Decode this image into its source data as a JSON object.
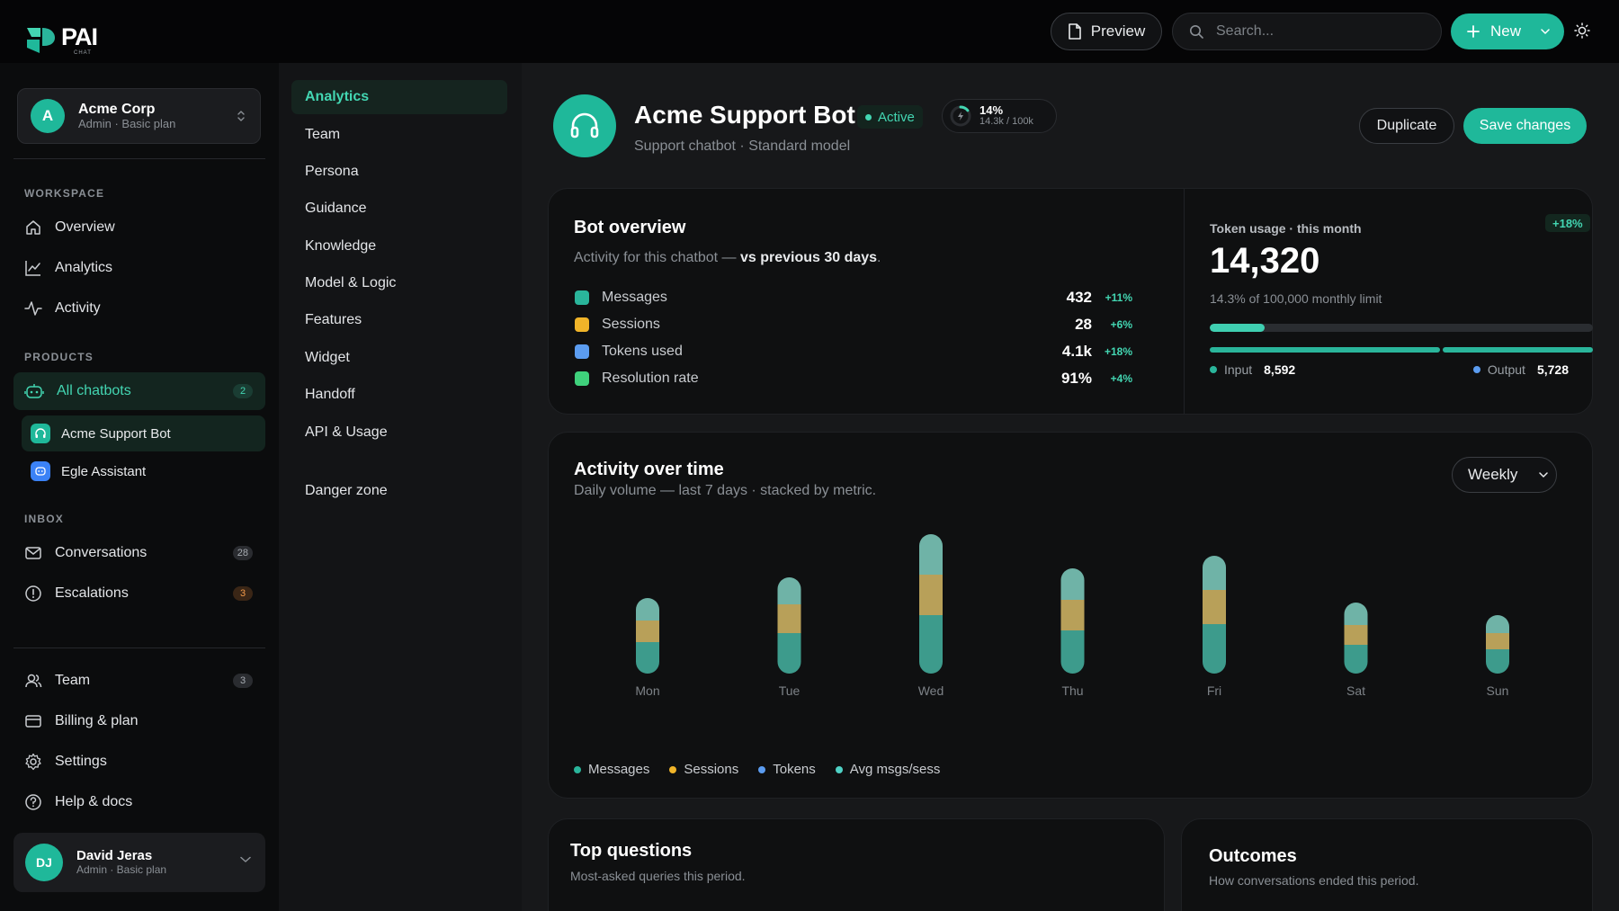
{
  "app": {
    "logo_text": "PAI",
    "logo_sub": "CHAT"
  },
  "topbar": {
    "preview_label": "Preview",
    "search_placeholder": "Search...",
    "new_label": "New"
  },
  "org": {
    "initial": "A",
    "name": "Acme Corp",
    "sub": "Admin · Basic plan"
  },
  "sidebar": {
    "workspace_label": "WORKSPACE",
    "workspace_items": [
      {
        "label": "Overview",
        "icon": "home-icon"
      },
      {
        "label": "Analytics",
        "icon": "line-chart-icon"
      },
      {
        "label": "Activity",
        "icon": "pulse-icon"
      }
    ],
    "products_label": "PRODUCTS",
    "all_chatbots": {
      "label": "All chatbots",
      "badge": "2"
    },
    "bots": [
      {
        "label": "Acme Support Bot",
        "color": "#1fb89a"
      },
      {
        "label": "Egle Assistant",
        "color": "#3b82f6"
      }
    ],
    "inbox_label": "INBOX",
    "inbox_items": [
      {
        "label": "Conversations",
        "badge": "28"
      },
      {
        "label": "Escalations",
        "badge": "3"
      }
    ],
    "bottom_items": [
      {
        "label": "Team",
        "badge": "3"
      },
      {
        "label": "Billing & plan"
      },
      {
        "label": "Settings"
      },
      {
        "label": "Help & docs"
      }
    ]
  },
  "user": {
    "initials": "DJ",
    "name": "David Jeras",
    "sub": "Admin · Basic plan"
  },
  "subnav": {
    "items": [
      "Analytics",
      "Team",
      "Persona",
      "Guidance",
      "Knowledge",
      "Model & Logic",
      "Features",
      "Widget",
      "Handoff",
      "API & Usage"
    ],
    "danger": "Danger zone"
  },
  "bot": {
    "name": "Acme Support Bot",
    "status": "Active",
    "usage_pct": "14%",
    "usage_sub": "14.3k / 100k",
    "usage_fraction": 0.143,
    "subtitle": "Support chatbot · Standard model",
    "duplicate_label": "Duplicate",
    "save_label": "Save changes"
  },
  "overview": {
    "title": "Bot overview",
    "subtitle_prefix": "Activity for this chatbot — ",
    "subtitle_bold": "vs previous 30 days",
    "subtitle_suffix": ".",
    "metrics": [
      {
        "label": "Messages",
        "value": "432",
        "delta": "+11%",
        "color": "#2ab59b"
      },
      {
        "label": "Sessions",
        "value": "28",
        "delta": "+6%",
        "color": "#f0b429"
      },
      {
        "label": "Tokens used",
        "value": "4.1k",
        "delta": "+18%",
        "color": "#5b9cf0"
      },
      {
        "label": "Resolution rate",
        "value": "91%",
        "delta": "+4%",
        "color": "#3fd17c"
      }
    ]
  },
  "tokens": {
    "label": "Token usage · this month",
    "delta": "+18%",
    "total": "14,320",
    "sub": "14.3% of 100,000 monthly limit",
    "fill_fraction": 0.143,
    "input_label": "Input",
    "input_value": "8,592",
    "output_label": "Output",
    "output_value": "5,728",
    "input_color": "#2ab59b",
    "output_color": "#5b9cf0"
  },
  "activity": {
    "title": "Activity over time",
    "subtitle": "Daily volume — last 7 days · stacked by metric.",
    "period": "Weekly"
  },
  "chart_data": {
    "type": "bar",
    "stacked": true,
    "categories": [
      "Mon",
      "Tue",
      "Wed",
      "Thu",
      "Fri",
      "Sat",
      "Sun"
    ],
    "series": [
      {
        "name": "Messages",
        "color": "#3d9b8c",
        "values": [
          35,
          45,
          65,
          48,
          55,
          32,
          27
        ]
      },
      {
        "name": "Sessions",
        "color": "#b8a059",
        "values": [
          24,
          32,
          45,
          34,
          38,
          22,
          18
        ]
      },
      {
        "name": "Tokens",
        "color": "#4f9e92",
        "values": [
          0,
          0,
          0,
          0,
          0,
          0,
          0
        ]
      },
      {
        "name": "Avg msgs/sess",
        "color": "#6fb3a7",
        "values": [
          25,
          30,
          45,
          35,
          38,
          25,
          20
        ]
      }
    ],
    "legend_colors": [
      "#2ab59b",
      "#f0b429",
      "#5b9cf0",
      "#4fd1c5"
    ],
    "ylim": [
      0,
      160
    ],
    "grid": false,
    "legend": "bottom-left"
  },
  "top_questions": {
    "title": "Top questions",
    "subtitle": "Most-asked queries this period."
  },
  "outcomes": {
    "title": "Outcomes",
    "subtitle": "How conversations ended this period."
  }
}
